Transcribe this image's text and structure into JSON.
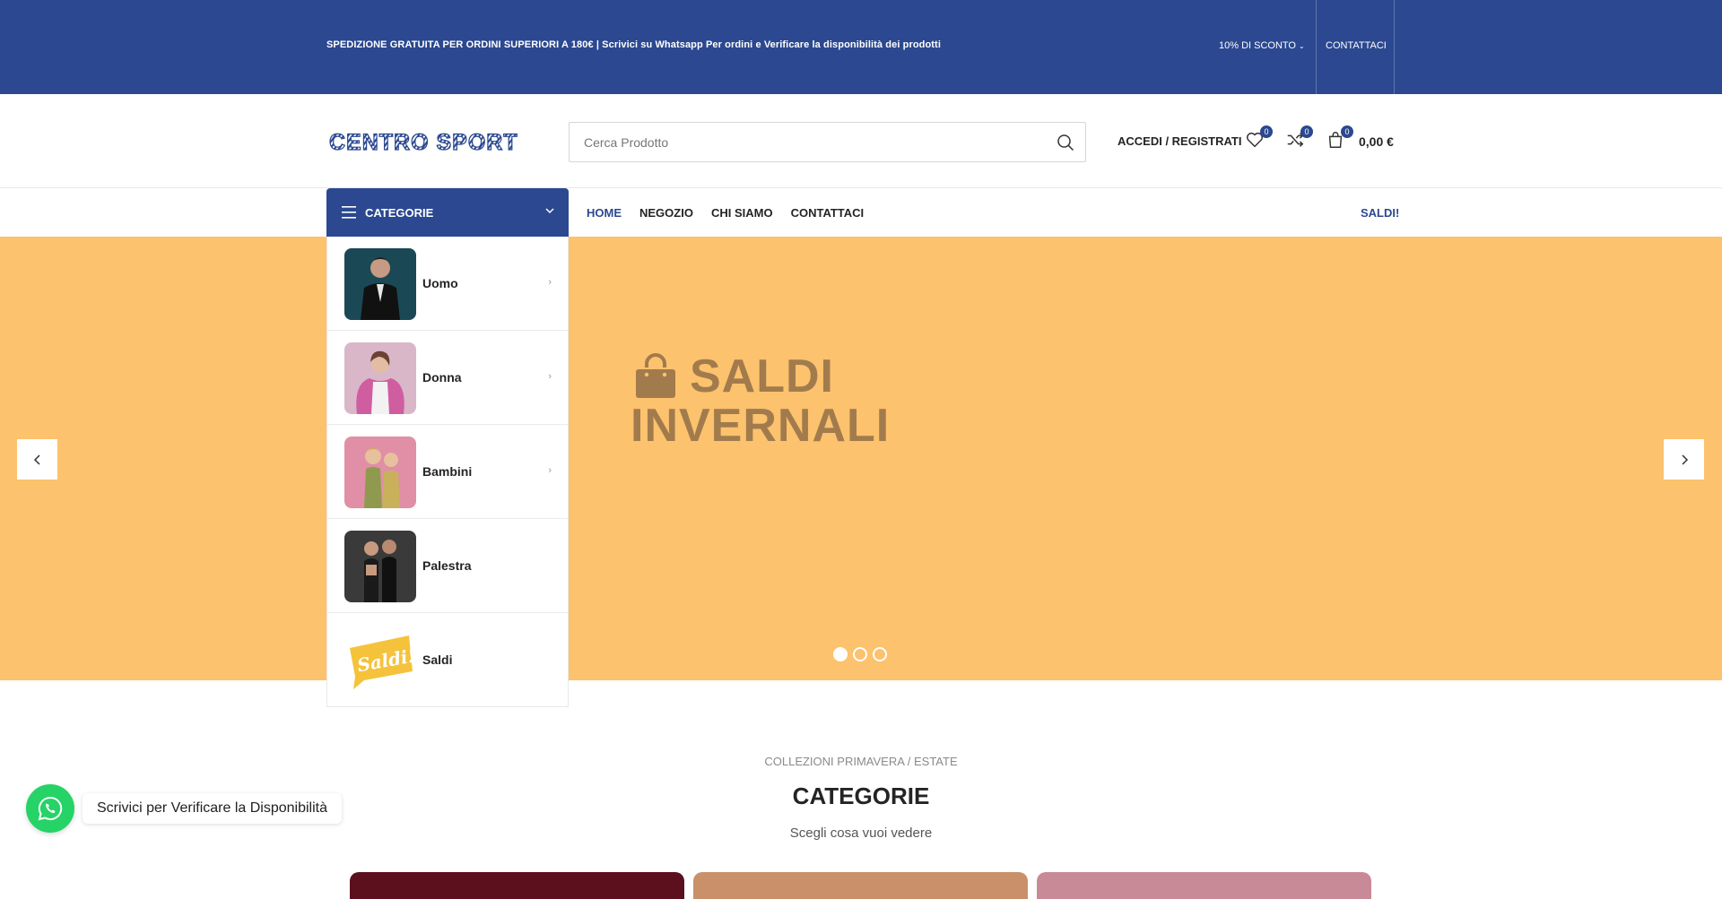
{
  "topbar": {
    "message": "SPEDIZIONE GRATUITA PER ORDINI SUPERIORI A 180€ | Scrivici su Whatsapp Per ordini e Verificare la disponibilità dei prodotti",
    "discount": "10% DI SCONTO",
    "contact": "CONTATTACI",
    "bg_color": "#2b4890"
  },
  "header": {
    "logo_text": "CENTRO SPORT",
    "search_placeholder": "Cerca Prodotto",
    "account_label": "ACCEDI / REGISTRATI",
    "wishlist_count": "0",
    "compare_count": "0",
    "cart_count": "0",
    "cart_total": "0,00 €"
  },
  "nav": {
    "categories_label": "CATEGORIE",
    "links": [
      "HOME",
      "NEGOZIO",
      "CHI SIAMO",
      "CONTATTACI"
    ],
    "active": "HOME",
    "sale_link": "SALDI!"
  },
  "category_menu": [
    {
      "name": "Uomo",
      "has_children": true
    },
    {
      "name": "Donna",
      "has_children": true
    },
    {
      "name": "Bambini",
      "has_children": true
    },
    {
      "name": "Palestra",
      "has_children": false
    },
    {
      "name": "Saldi",
      "has_children": false
    }
  ],
  "hero": {
    "line1": "SALDI",
    "line2": "INVERNALI",
    "bg_color": "#fcc26d",
    "text_color": "#a27b4d",
    "slides": 3,
    "active_slide": 1
  },
  "collections": {
    "subtitle": "COLLEZIONI PRIMAVERA / ESTATE",
    "title": "CATEGORIE",
    "description": "Scegli cosa vuoi vedere"
  },
  "whatsapp": {
    "label": "Scrivici per Verificare la Disponibilità",
    "color": "#25d366"
  }
}
